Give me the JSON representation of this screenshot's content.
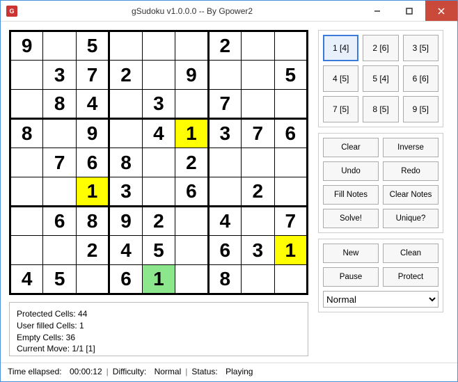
{
  "window": {
    "title": "gSudoku v1.0.0.0 -- By Gpower2",
    "icon_letter": "G"
  },
  "board": [
    [
      "9",
      "",
      "5",
      "",
      "",
      "",
      "2",
      "",
      ""
    ],
    [
      "",
      "3",
      "7",
      "2",
      "",
      "9",
      "",
      "",
      "5"
    ],
    [
      "",
      "8",
      "4",
      "",
      "3",
      "",
      "7",
      "",
      ""
    ],
    [
      "8",
      "",
      "9",
      "",
      "4",
      "1",
      "3",
      "7",
      "6"
    ],
    [
      "",
      "7",
      "6",
      "8",
      "",
      "2",
      "",
      "",
      ""
    ],
    [
      "",
      "",
      "1",
      "3",
      "",
      "6",
      "",
      "2",
      ""
    ],
    [
      "",
      "6",
      "8",
      "9",
      "2",
      "",
      "4",
      "",
      "7"
    ],
    [
      "",
      "",
      "2",
      "4",
      "5",
      "",
      "6",
      "3",
      "1"
    ],
    [
      "4",
      "5",
      "",
      "6",
      "1",
      "",
      "8",
      "",
      ""
    ]
  ],
  "highlights": {
    "yellow": [
      [
        3,
        5
      ],
      [
        5,
        2
      ],
      [
        7,
        8
      ]
    ],
    "green": [
      [
        8,
        4
      ]
    ]
  },
  "numpad": [
    "1 [4]",
    "2 [6]",
    "3 [5]",
    "4 [5]",
    "5 [4]",
    "6 [6]",
    "7 [5]",
    "8 [5]",
    "9 [5]"
  ],
  "numpad_selected": 0,
  "buttons": {
    "group1": [
      "Clear",
      "Inverse",
      "Undo",
      "Redo",
      "Fill Notes",
      "Clear Notes",
      "Solve!",
      "Unique?"
    ],
    "group2": [
      "New",
      "Clean",
      "Pause",
      "Protect"
    ]
  },
  "difficulty_select": "Normal",
  "info": {
    "protected": "Protected Cells: 44",
    "userfilled": "User filled Cells: 1",
    "empty": "Empty Cells: 36",
    "currentmove": "Current Move: 1/1 [1]"
  },
  "status": {
    "time_label": "Time ellapsed:",
    "time_value": "00:00:12",
    "diff_label": "Difficulty:",
    "diff_value": "Normal",
    "status_label": "Status:",
    "status_value": "Playing"
  }
}
